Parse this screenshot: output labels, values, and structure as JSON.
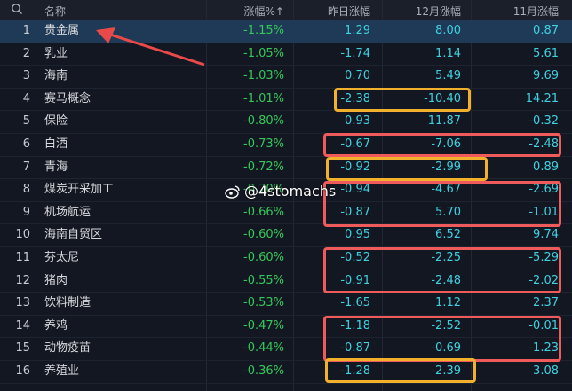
{
  "header": {
    "search_icon": "search-icon",
    "name": "名称",
    "change": "涨幅%↑",
    "yesterday": "昨日涨幅",
    "december": "12月涨幅",
    "november": "11月涨幅"
  },
  "rows": [
    {
      "idx": "1",
      "name": "贵金属",
      "chg": "-1.15%",
      "y": "1.29",
      "d": "8.00",
      "n": "0.87"
    },
    {
      "idx": "2",
      "name": "乳业",
      "chg": "-1.05%",
      "y": "-1.74",
      "d": "1.14",
      "n": "5.61"
    },
    {
      "idx": "3",
      "name": "海南",
      "chg": "-1.03%",
      "y": "0.70",
      "d": "5.49",
      "n": "9.69"
    },
    {
      "idx": "4",
      "name": "赛马概念",
      "chg": "-1.01%",
      "y": "-2.38",
      "d": "-10.40",
      "n": "14.21"
    },
    {
      "idx": "5",
      "name": "保险",
      "chg": "-0.80%",
      "y": "0.93",
      "d": "11.87",
      "n": "-0.32"
    },
    {
      "idx": "6",
      "name": "白酒",
      "chg": "-0.73%",
      "y": "-0.67",
      "d": "-7.06",
      "n": "-2.48"
    },
    {
      "idx": "7",
      "name": "青海",
      "chg": "-0.72%",
      "y": "-0.92",
      "d": "-2.99",
      "n": "0.89"
    },
    {
      "idx": "8",
      "name": "煤炭开采加工",
      "chg": "-0.70%",
      "y": "-0.94",
      "d": "-4.67",
      "n": "-2.69"
    },
    {
      "idx": "9",
      "name": "机场航运",
      "chg": "-0.66%",
      "y": "-0.87",
      "d": "5.70",
      "n": "-1.01"
    },
    {
      "idx": "10",
      "name": "海南自贸区",
      "chg": "-0.60%",
      "y": "0.95",
      "d": "6.52",
      "n": "9.74"
    },
    {
      "idx": "11",
      "name": "芬太尼",
      "chg": "-0.60%",
      "y": "-0.52",
      "d": "-2.25",
      "n": "-5.29"
    },
    {
      "idx": "12",
      "name": "猪肉",
      "chg": "-0.55%",
      "y": "-0.91",
      "d": "-2.48",
      "n": "-2.02"
    },
    {
      "idx": "13",
      "name": "饮料制造",
      "chg": "-0.53%",
      "y": "-1.65",
      "d": "1.12",
      "n": "2.37"
    },
    {
      "idx": "14",
      "name": "养鸡",
      "chg": "-0.47%",
      "y": "-1.18",
      "d": "-2.52",
      "n": "-0.01"
    },
    {
      "idx": "15",
      "name": "动物疫苗",
      "chg": "-0.44%",
      "y": "-0.87",
      "d": "-0.69",
      "n": "-1.23"
    },
    {
      "idx": "16",
      "name": "养殖业",
      "chg": "-0.36%",
      "y": "-1.28",
      "d": "-2.39",
      "n": "3.08"
    }
  ],
  "watermark": "@4stomachs",
  "colors": {
    "negative": "#34c759",
    "value": "#3fd0e0",
    "highlight_yellow": "#f2b12c",
    "highlight_red": "#ef5a5a",
    "arrow": "#e84a4a"
  }
}
